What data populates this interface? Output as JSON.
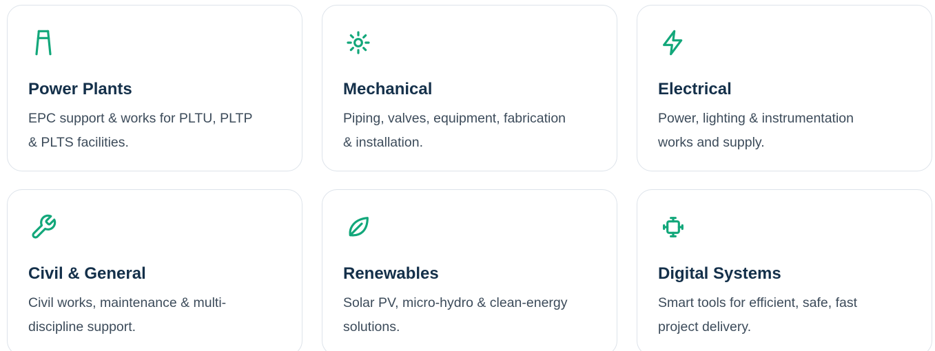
{
  "accent_color": "#12a77a",
  "cards": [
    {
      "icon": "transmission-tower-icon",
      "title": "Power Plants",
      "description": "EPC support & works for PLTU, PLTP & PLTS facilities."
    },
    {
      "icon": "sun-icon",
      "title": "Mechanical",
      "description": "Piping, valves, equipment, fabrication & installation."
    },
    {
      "icon": "lightning-bolt-icon",
      "title": "Electrical",
      "description": "Power, lighting & instrumentation works and supply."
    },
    {
      "icon": "wrench-icon",
      "title": "Civil & General",
      "description": "Civil works, maintenance & multi-discipline support."
    },
    {
      "icon": "leaf-icon",
      "title": "Renewables",
      "description": "Solar PV, micro-hydro & clean-energy solutions."
    },
    {
      "icon": "cpu-chip-icon",
      "title": "Digital Systems",
      "description": "Smart tools for efficient, safe, fast project delivery."
    }
  ]
}
